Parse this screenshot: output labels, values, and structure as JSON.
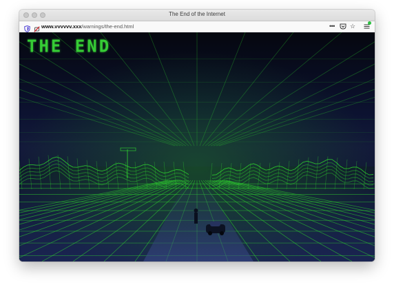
{
  "window": {
    "title": "The End of the Internet"
  },
  "toolbar": {
    "url_domain": "www.vvvvvv.xxx",
    "url_path": "/warnings/the-end.html",
    "more_icon": "•••",
    "star_icon": "☆",
    "icons": [
      "shield-icon",
      "no-permission-icon",
      "more-icon",
      "pocket-icon",
      "bookmark-star-icon",
      "menu-icon"
    ]
  },
  "page": {
    "heading": "THE END",
    "heading_color": "#36cc35",
    "background_color": "#090d1c",
    "grid_color": "#2fd62f"
  }
}
